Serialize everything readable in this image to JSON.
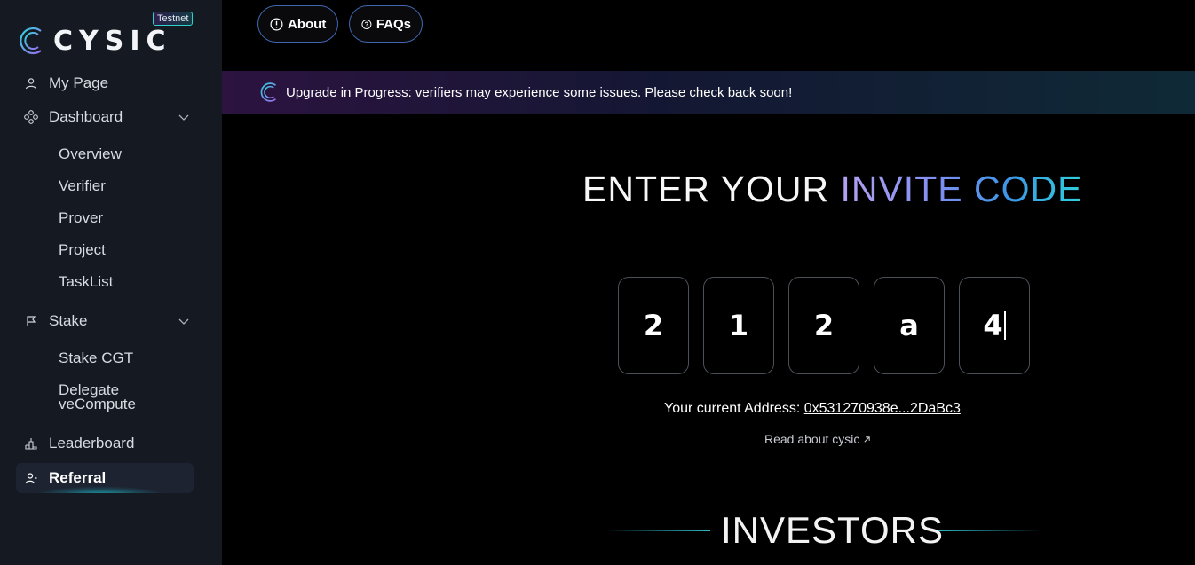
{
  "sidebar": {
    "logo_text": "CYSIC",
    "badge": "Testnet",
    "items": [
      {
        "label": "My Page",
        "icon": "user-icon"
      },
      {
        "label": "Dashboard",
        "icon": "dashboard-icon"
      },
      {
        "label": "Stake",
        "icon": "flag-icon"
      },
      {
        "label": "Leaderboard",
        "icon": "podium-icon"
      },
      {
        "label": "Referral",
        "icon": "referral-icon"
      }
    ],
    "dashboard_sub": [
      "Overview",
      "Verifier",
      "Prover",
      "Project",
      "TaskList"
    ],
    "stake_sub": [
      "Stake CGT",
      "Delegate",
      "veCompute"
    ],
    "active": "Referral"
  },
  "topbar": {
    "about_label": "About",
    "faqs_label": "FAQs"
  },
  "banner": {
    "text": "Upgrade in Progress: verifiers may experience some issues. Please check back soon!"
  },
  "invite": {
    "heading_part1": "ENTER YOUR ",
    "heading_part2": "INVITE CODE",
    "code": [
      "2",
      "1",
      "2",
      "a",
      "4"
    ],
    "address_label": "Your current Address: ",
    "address_value": "0x531270938e...2DaBc3",
    "read_label": "Read about cysic"
  },
  "investors": {
    "title": "INVESTORS"
  },
  "colors": {
    "sidebar_bg": "#141922",
    "accent_cyan": "#2fd0dc",
    "accent_purple": "#b6a1f0"
  }
}
